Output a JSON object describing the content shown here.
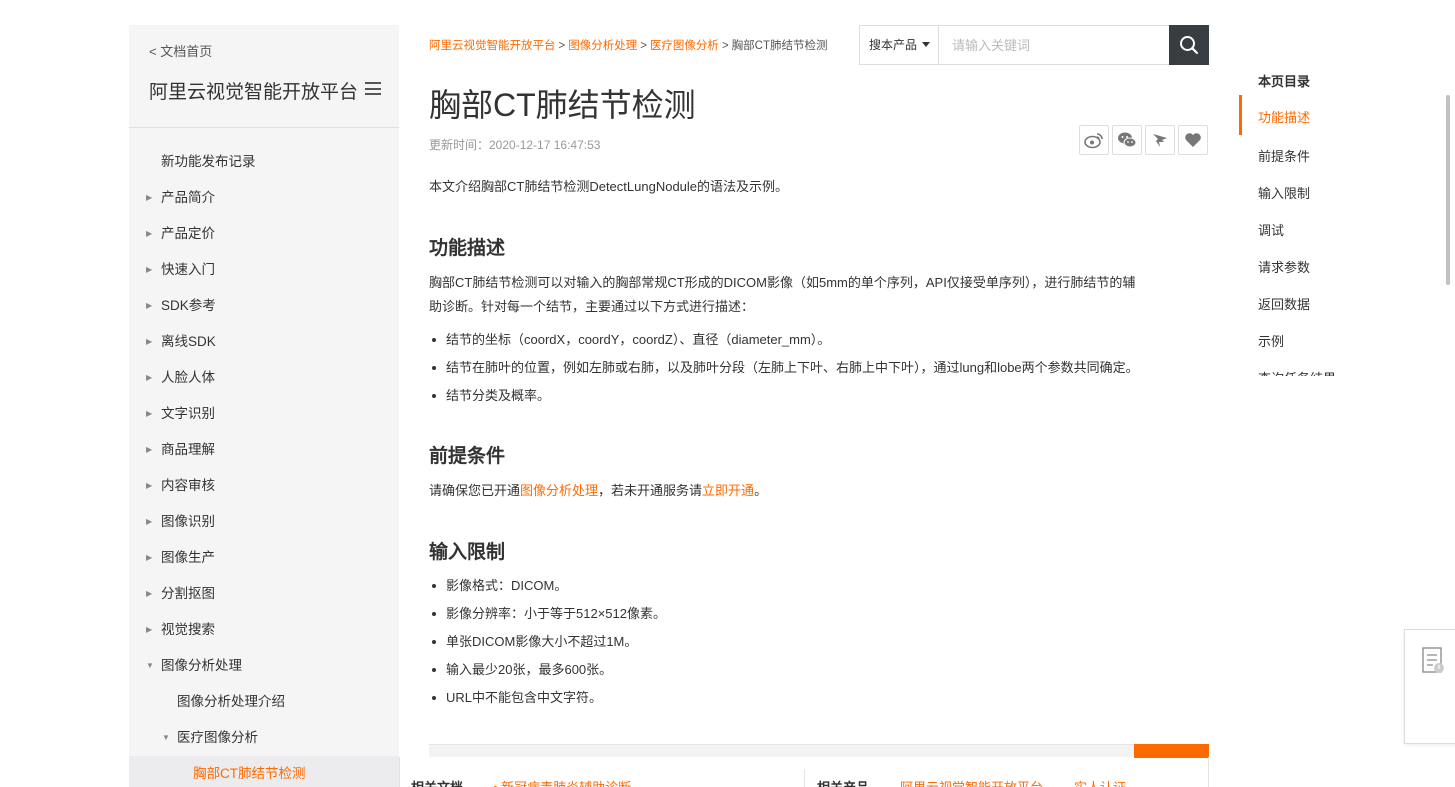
{
  "sidebar": {
    "home_link": "< 文档首页",
    "title": "阿里云视觉智能开放平台",
    "items": [
      {
        "label": "新功能发布记录"
      },
      {
        "label": "产品简介"
      },
      {
        "label": "产品定价"
      },
      {
        "label": "快速入门"
      },
      {
        "label": "SDK参考"
      },
      {
        "label": "离线SDK"
      },
      {
        "label": "人脸人体"
      },
      {
        "label": "文字识别"
      },
      {
        "label": "商品理解"
      },
      {
        "label": "内容审核"
      },
      {
        "label": "图像识别"
      },
      {
        "label": "图像生产"
      },
      {
        "label": "分割抠图"
      },
      {
        "label": "视觉搜索"
      },
      {
        "label": "图像分析处理"
      },
      {
        "label": "图像分析处理介绍"
      },
      {
        "label": "医疗图像分析"
      },
      {
        "label": "胸部CT肺结节检测"
      }
    ]
  },
  "breadcrumb": {
    "items": [
      "阿里云视觉智能开放平台",
      "图像分析处理",
      "医疗图像分析"
    ],
    "separator": ">",
    "current": "胸部CT肺结节检测"
  },
  "search": {
    "scope": "搜本产品",
    "placeholder": "请输入关键词"
  },
  "article": {
    "title": "胸部CT肺结节检测",
    "updated": "更新时间：2020-12-17 16:47:53",
    "intro": "本文介绍胸部CT肺结节检测DetectLungNodule的语法及示例。",
    "sections": {
      "features": {
        "heading": "功能描述",
        "line1": "胸部CT肺结节检测可以对输入的胸部常规CT形成的DICOM影像（如5mm的单个序列，API仅接受单序列），进行肺结节的辅",
        "line2": "助诊断。针对每一个结节，主要通过以下方式进行描述：",
        "bullets": [
          "结节的坐标（coordX，coordY，coordZ）、直径（diameter_mm）。",
          "结节在肺叶的位置，例如左肺或右肺，以及肺叶分段（左肺上下叶、右肺上中下叶），通过lung和lobe两个参数共同确定。",
          "结节分类及概率。"
        ]
      },
      "prereq": {
        "heading": "前提条件",
        "text_a": "请确保您已开通",
        "link_a": "图像分析处理",
        "text_b": "，若未开通服务请",
        "link_b": "立即开通",
        "text_c": "。"
      },
      "limits": {
        "heading": "输入限制",
        "bullets": [
          "影像格式：DICOM。",
          "影像分辨率：小于等于512×512像素。",
          "单张DICOM影像大小不超过1M。",
          "输入最少20张，最多600张。",
          "URL中不能包含中文字符。"
        ]
      }
    }
  },
  "bottom": {
    "related_docs_label": "相关文档",
    "related_doc_link": "• 新冠病毒肺炎辅助诊断",
    "related_products_label": "相关产品",
    "related_product_1": "阿里云视觉智能开放平台",
    "related_product_2": "实人认证"
  },
  "toc": {
    "title": "本页目录",
    "items": [
      "功能描述",
      "前提条件",
      "输入限制",
      "调试",
      "请求参数",
      "返回数据",
      "示例",
      "查询任务结果"
    ]
  },
  "colors": {
    "accent": "#ff6a00",
    "sidebar_bg": "#f5f5f6",
    "search_button": "#373d41"
  },
  "icons": [
    "menu-icon",
    "search-icon",
    "weibo-icon",
    "wechat-icon",
    "dingtalk-icon",
    "heart-icon",
    "feedback-icon"
  ]
}
